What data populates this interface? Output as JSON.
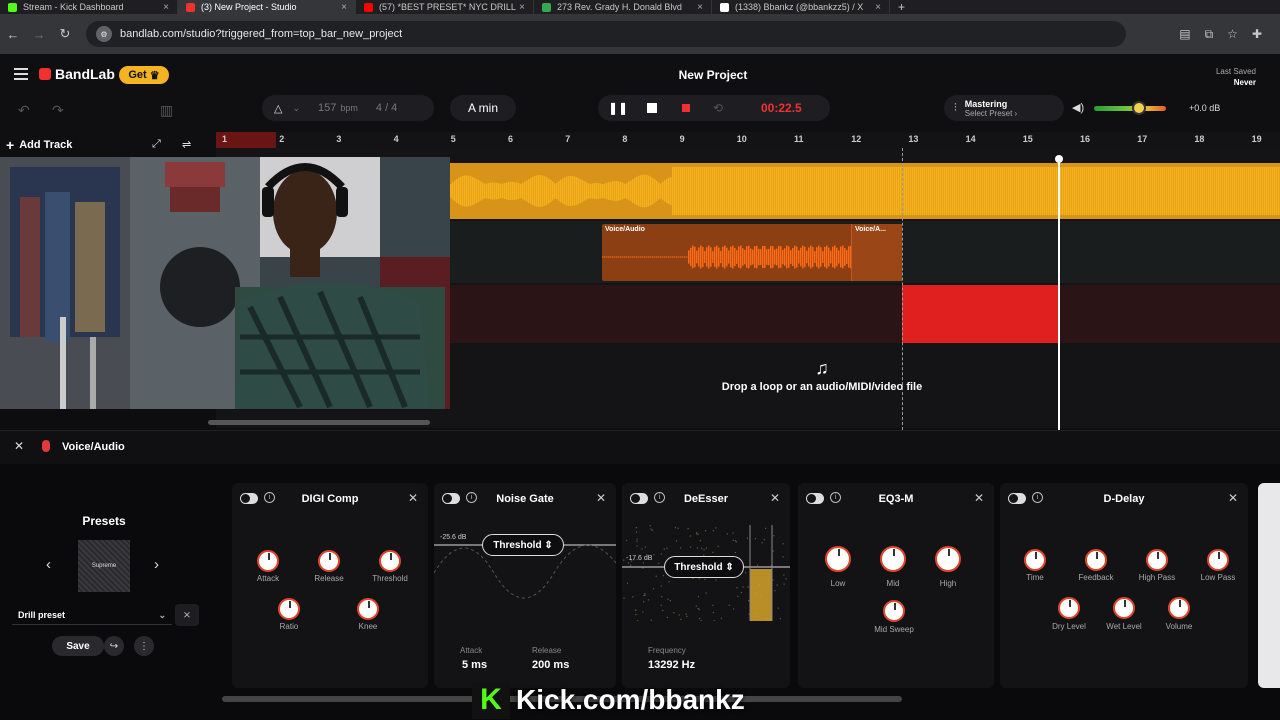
{
  "browser": {
    "tabs": [
      {
        "title": "Stream - Kick Dashboard",
        "color": "#53fc18"
      },
      {
        "title": "(3) New Project - Studio",
        "color": "#f23030"
      },
      {
        "title": "(57) *BEST PRESET* NYC DRILL",
        "color": "#ff0000"
      },
      {
        "title": "273 Rev. Grady H. Donald Blvd",
        "color": "#34a853"
      },
      {
        "title": "(1338) Bbankz (@bbankzz5) / X",
        "color": "#ffffff"
      }
    ],
    "url": "bandlab.com/studio?triggered_from=top_bar_new_project"
  },
  "app": {
    "brand": "BandLab",
    "get_label": "Get",
    "project_title": "New Project",
    "last_saved_label": "Last Saved",
    "last_saved_value": "Never"
  },
  "toolbar": {
    "bpm_value": "157",
    "bpm_unit": "bpm",
    "time_signature": "4 / 4",
    "key": "A min",
    "timer": "00:22.5",
    "mastering_label": "Mastering",
    "mastering_preset": "Select Preset",
    "volume_db": "+0.0 dB",
    "volume_level": 0.62
  },
  "tracks": {
    "add_track_label": "Add Track",
    "ruler": [
      "1",
      "2",
      "3",
      "4",
      "5",
      "6",
      "7",
      "8",
      "9",
      "10",
      "11",
      "12",
      "13",
      "14",
      "15",
      "16",
      "17",
      "18",
      "19"
    ],
    "clip_voice_label": "Voice/Audio",
    "clip_voice2_label": "Voice/A...",
    "drop_hint": "Drop a loop or an audio/MIDI/video file"
  },
  "panel": {
    "title": "Voice/Audio",
    "presets_title": "Presets",
    "preset_thumb": "Supreme",
    "preset_selected": "Drill preset",
    "save_label": "Save"
  },
  "effects": {
    "digi_comp": {
      "name": "DIGI Comp",
      "knobs": [
        "Attack",
        "Release",
        "Threshold",
        "Ratio",
        "Knee"
      ]
    },
    "noise_gate": {
      "name": "Noise Gate",
      "threshold_label": "Threshold",
      "db": "-25.6 dB",
      "attack_label": "Attack",
      "attack_value": "5 ms",
      "release_label": "Release",
      "release_value": "200 ms"
    },
    "deesser": {
      "name": "DeEsser",
      "threshold_label": "Threshold",
      "db": "-17.6 dB",
      "frequency_label": "Frequency",
      "frequency_value": "13292 Hz"
    },
    "eq3m": {
      "name": "EQ3-M",
      "knobs": [
        "Low",
        "Mid",
        "High",
        "Mid Sweep"
      ]
    },
    "ddelay": {
      "name": "D-Delay",
      "knobs": [
        "Time",
        "Feedback",
        "High Pass",
        "Low Pass",
        "Dry Level",
        "Wet Level",
        "Volume"
      ]
    }
  },
  "overlay": {
    "kick_logo": "K",
    "kick_text": "Kick.com/bbankz"
  }
}
